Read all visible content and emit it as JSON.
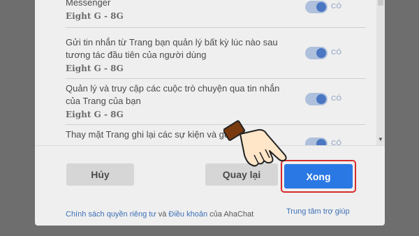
{
  "permissions": [
    {
      "text": "Messenger",
      "page": "Eight G - 8G",
      "toggle_label": "CÓ",
      "on": true
    },
    {
      "text": "Gửi tin nhắn từ Trang bạn quản lý bất kỳ lúc nào sau tương tác đầu tiên của người dùng",
      "page": "Eight G - 8G",
      "toggle_label": "CÓ",
      "on": true
    },
    {
      "text": "Quản lý và truy cập các cuộc trò chuyện qua tin nhắn của Trang của bạn",
      "page": "Eight G - 8G",
      "toggle_label": "CÓ",
      "on": true
    },
    {
      "text": "Thay mặt Trang ghi lại các sự kiện và gửi",
      "toggle_label": "CÓ",
      "on": true
    }
  ],
  "buttons": {
    "cancel": "Hủy",
    "back": "Quay lại",
    "done": "Xong"
  },
  "footer": {
    "privacy": "Chính sách quyền riêng tư",
    "and": "và",
    "terms": "Điều khoản",
    "of_app": "của AhaChat",
    "help": "Trung tâm trợ giúp"
  },
  "colors": {
    "primary": "#2a78e4",
    "highlight": "#d62c2c",
    "toggle_on": "#4a76c2"
  },
  "icons": {
    "pointer": "hand-pointer-icon"
  }
}
